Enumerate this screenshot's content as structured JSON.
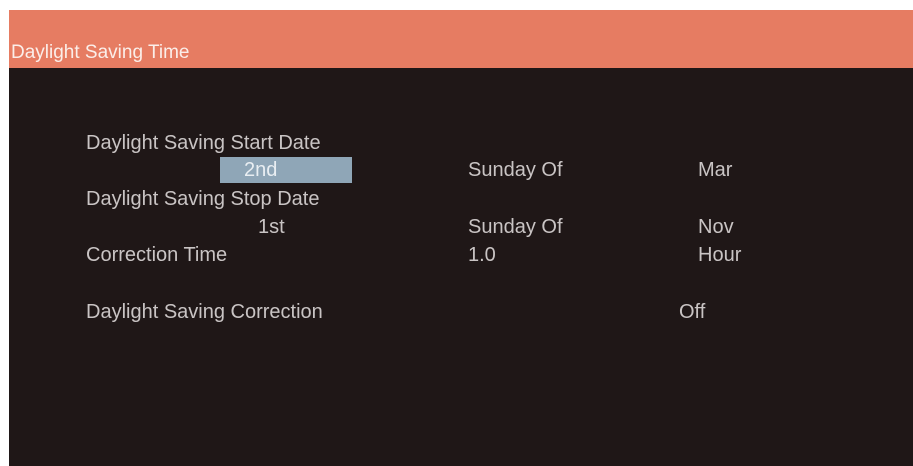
{
  "window": {
    "title": "Daylight Saving Time"
  },
  "start": {
    "label": "Daylight Saving Start Date",
    "week": "2nd",
    "day": "Sunday Of",
    "month": "Mar"
  },
  "stop": {
    "label": "Daylight Saving Stop Date",
    "week": "1st",
    "day": "Sunday Of",
    "month": "Nov"
  },
  "correction_time": {
    "label": "Correction Time",
    "value": "1.0",
    "unit": "Hour"
  },
  "correction": {
    "label": "Daylight Saving Correction",
    "value": "Off"
  },
  "colors": {
    "title_bar": "#e67c62",
    "background": "#1f1717",
    "text": "#c9c4c4",
    "selection": "#8fa6b7"
  }
}
